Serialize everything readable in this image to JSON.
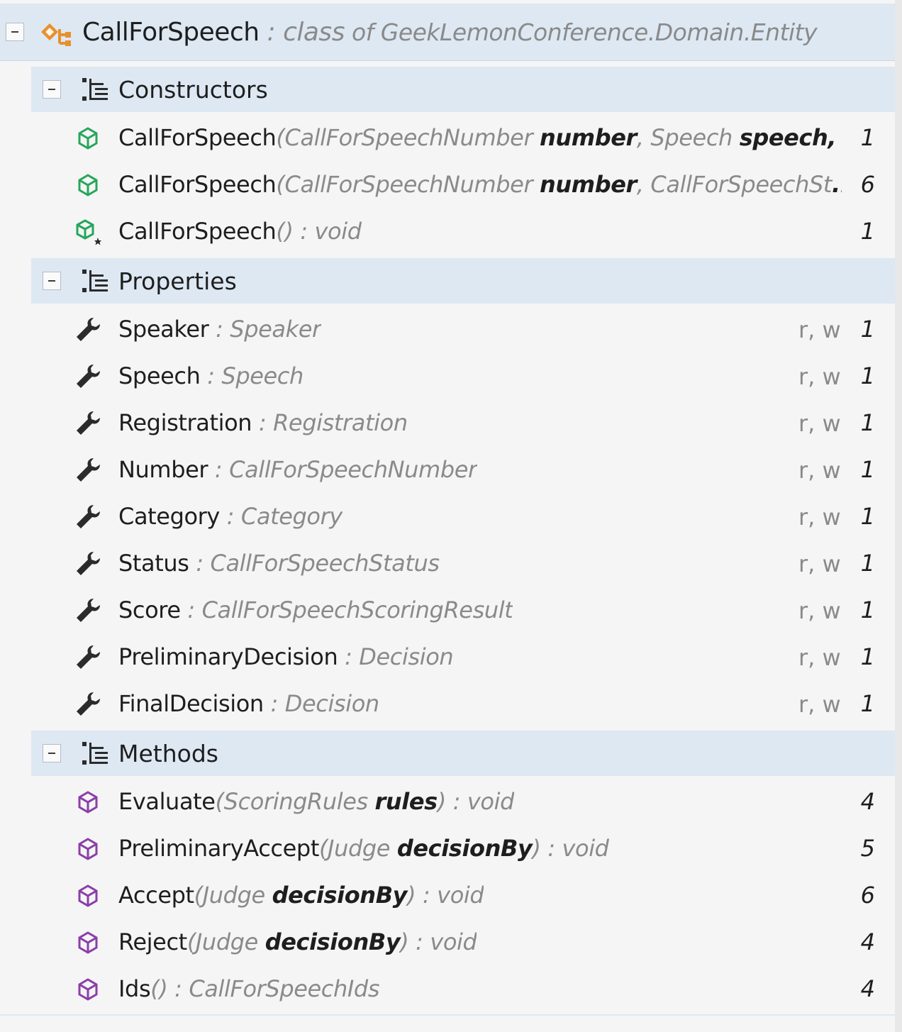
{
  "header": {
    "name": "CallForSpeech",
    "kind": " : class",
    "of_label": " of ",
    "namespace": "GeekLemonConference.Domain.Entity",
    "icon": "class-icon"
  },
  "colors": {
    "section_bg": "#dde8f3",
    "constructor_icon": "#26a65b",
    "method_icon": "#8a3fa8",
    "property_icon": "#2b2b2b",
    "class_icon": "#e8902b",
    "muted_text": "#8a8a8a"
  },
  "sections": {
    "constructors": {
      "label": "Constructors",
      "items": [
        {
          "name": "CallForSpeech",
          "p1": "(CallForSpeechNumber ",
          "b1": "number",
          "p2": ", Speech ",
          "b2": "speech,",
          "tail": "...",
          "count": "1"
        },
        {
          "name": "CallForSpeech",
          "p1": "(CallForSpeechNumber ",
          "b1": "number",
          "p2": ", CallForSpeechSt",
          "tail": "...",
          "count": "6"
        },
        {
          "name": "CallForSpeech",
          "p1": "()",
          "type": " : void",
          "count": "1"
        }
      ]
    },
    "properties": {
      "label": "Properties",
      "items": [
        {
          "name": "Speaker",
          "type": " : Speaker",
          "access": "r, w",
          "count": "1"
        },
        {
          "name": "Speech",
          "type": " : Speech",
          "access": "r, w",
          "count": "1"
        },
        {
          "name": "Registration",
          "type": " : Registration",
          "access": "r, w",
          "count": "1"
        },
        {
          "name": "Number",
          "type": " : CallForSpeechNumber",
          "access": "r, w",
          "count": "1"
        },
        {
          "name": "Category",
          "type": " : Category",
          "access": "r, w",
          "count": "1"
        },
        {
          "name": "Status",
          "type": " : CallForSpeechStatus",
          "access": "r, w",
          "count": "1"
        },
        {
          "name": "Score",
          "type": " : CallForSpeechScoringResult",
          "access": "r, w",
          "count": "1"
        },
        {
          "name": "PreliminaryDecision",
          "type": " : Decision",
          "access": "r, w",
          "count": "1"
        },
        {
          "name": "FinalDecision",
          "type": " : Decision",
          "access": "r, w",
          "count": "1"
        }
      ]
    },
    "methods": {
      "label": "Methods",
      "items": [
        {
          "name": "Evaluate",
          "p1": "(ScoringRules ",
          "b1": "rules",
          "p2": ")",
          "type": " : void",
          "count": "4"
        },
        {
          "name": "PreliminaryAccept",
          "p1": "(Judge ",
          "b1": "decisionBy",
          "p2": ")",
          "type": " : void",
          "count": "5"
        },
        {
          "name": "Accept",
          "p1": "(Judge ",
          "b1": "decisionBy",
          "p2": ")",
          "type": " : void",
          "count": "6"
        },
        {
          "name": "Reject",
          "p1": "(Judge ",
          "b1": "decisionBy",
          "p2": ")",
          "type": " : void",
          "count": "4"
        },
        {
          "name": "Ids",
          "p1": "()",
          "type": " : CallForSpeechIds",
          "count": "4"
        }
      ]
    }
  }
}
